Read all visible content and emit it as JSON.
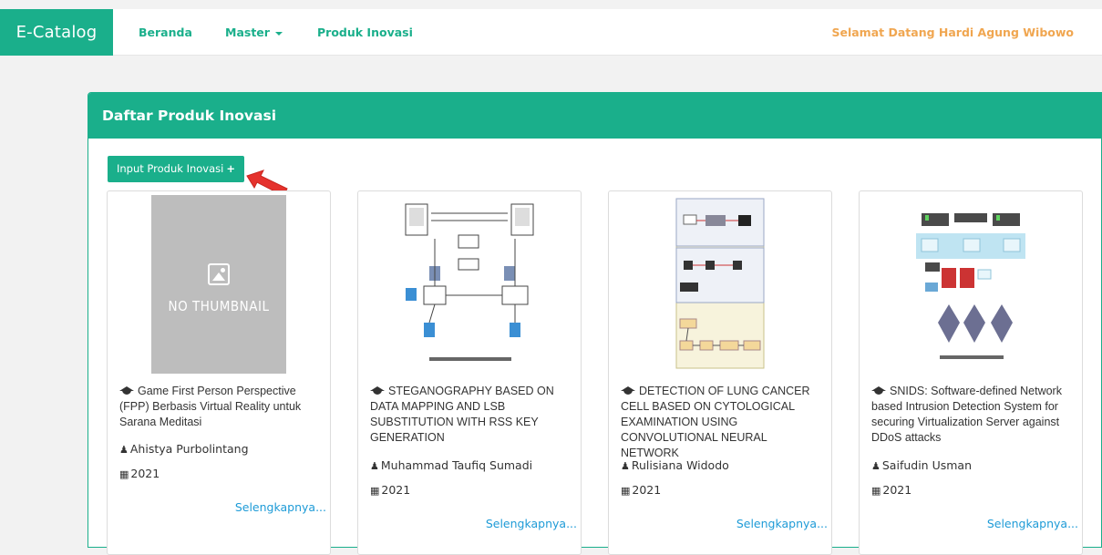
{
  "navbar": {
    "brand": "E-Catalog",
    "links": [
      "Beranda",
      "Master",
      "Produk Inovasi"
    ],
    "welcome": "Selamat Datang Hardi Agung Wibowo"
  },
  "panel": {
    "title": "Daftar Produk Inovasi",
    "input_button": "Input Produk Inovasi"
  },
  "cards": [
    {
      "title": "Game First Person Perspective (FPP) Berbasis Virtual Reality untuk Sarana Meditasi",
      "author": "Ahistya Purbolintang",
      "year": "2021",
      "link": "Selengkapnya...",
      "thumbnail_text": "NO THUMBNAIL"
    },
    {
      "title": "STEGANOGRAPHY BASED ON DATA MAPPING AND LSB SUBSTITUTION WITH RSS KEY GENERATION",
      "author": "Muhammad Taufiq Sumadi",
      "year": "2021",
      "link": "Selengkapnya..."
    },
    {
      "title": "DETECTION OF LUNG CANCER CELL BASED ON CYTOLOGICAL EXAMINATION USING CONVOLUTIONAL NEURAL NETWORK",
      "author": "Rulisiana Widodo",
      "year": "2021",
      "link": "Selengkapnya..."
    },
    {
      "title": "SNIDS: Software-defined Network based Intrusion Detection System for securing Virtualization Server against DDoS attacks",
      "author": "Saifudin Usman",
      "year": "2021",
      "link": "Selengkapnya..."
    }
  ],
  "colors": {
    "accent": "#1aaf8b",
    "welcome": "#f0a650",
    "link": "#1e9bd7",
    "arrow": "#e5322d"
  }
}
